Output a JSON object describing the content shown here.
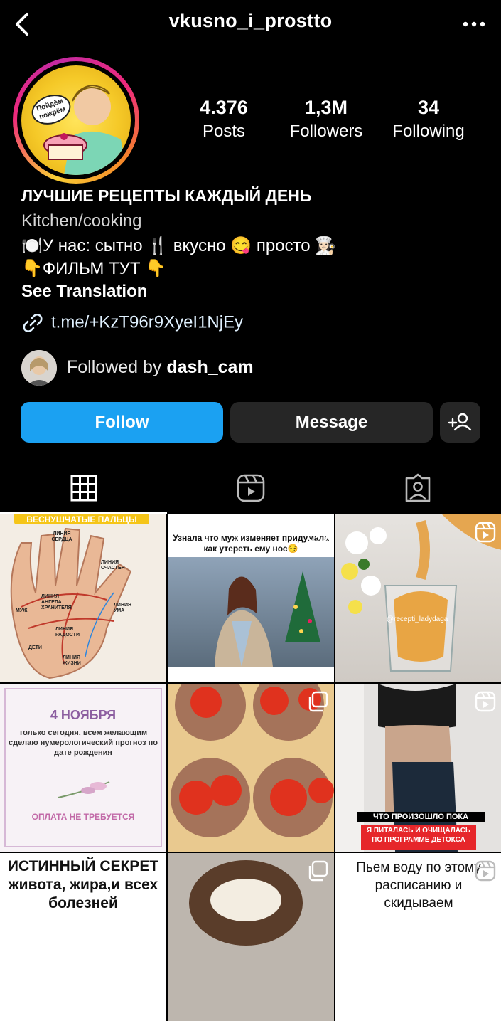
{
  "header": {
    "username": "vkusno_i_prostto",
    "back_icon": "chevron-left-icon",
    "more_icon": "more-horizontal-icon"
  },
  "profile": {
    "avatar_text": "Пойдём пожрём",
    "stats": [
      {
        "value": "4.376",
        "label": "Posts"
      },
      {
        "value": "1,3M",
        "label": "Followers"
      },
      {
        "value": "34",
        "label": "Following"
      }
    ],
    "bio_title": "ЛУЧШИЕ РЕЦЕПТЫ КАЖДЫЙ ДЕНЬ",
    "category": "Kitchen/cooking",
    "bio_line1": "🍽️У нас: сытно 🍴 вкусно 😋 просто 👩🏻‍🍳",
    "bio_line2": "👇ФИЛЬМ ТУТ 👇",
    "see_translation": "See Translation",
    "link": "t.me/+KzT96r9XyeI1NjEy",
    "followed_by_prefix": "Followed by ",
    "followed_by_user": "dash_cam"
  },
  "actions": {
    "follow": "Follow",
    "message": "Message",
    "add_user_icon": "add-person-icon"
  },
  "tabs": [
    {
      "icon": "grid-icon",
      "selected": true
    },
    {
      "icon": "reels-icon",
      "selected": false
    },
    {
      "icon": "tagged-icon",
      "selected": false
    }
  ],
  "posts": [
    {
      "caption": "ВЕСНУШЧАТЫЕ ПАЛЬЦЫ",
      "labels": [
        "ЛИНИЯ СЕРДЦА",
        "ЛИНИЯ СЧАСТЬЯ",
        "ЛИНИЯ АНГЕЛА ХРАНИТЕЛЯ",
        "ЛИНИЯ УМА",
        "ЛИНИЯ РАДОСТИ",
        "ЛИНИЯ ЖИЗНИ",
        "ДЕТИ",
        "МУЖ"
      ]
    },
    {
      "caption": "Узнала что муж изменяет придумала как утереть ему нос😏",
      "badge": "reel-icon"
    },
    {
      "caption": "@recepti_ladydaga",
      "badge": "reel-icon"
    },
    {
      "title": "4 НОЯБРЯ",
      "caption": "только сегодня, всем желающим сделаю нумерологический прогноз по дате рождения",
      "footer": "ОПЛАТА НЕ ТРЕБУЕТСЯ"
    },
    {
      "badge": "carousel-icon"
    },
    {
      "caption": "ЧТО ПРОИЗОШЛО ПОКА",
      "subcaption": "Я ПИТАЛАСЬ И ОЧИЩАЛАСЬ ПО ПРОГРАММЕ ДЕТОКСА",
      "badge": "reel-icon"
    },
    {
      "caption": "ИСТИННЫЙ СЕКРЕТ живота, жира,и всех болезней"
    },
    {
      "badge": "carousel-icon"
    },
    {
      "caption": "Пьем воду по этому расписанию и скидываем",
      "badge": "reel-icon"
    }
  ]
}
